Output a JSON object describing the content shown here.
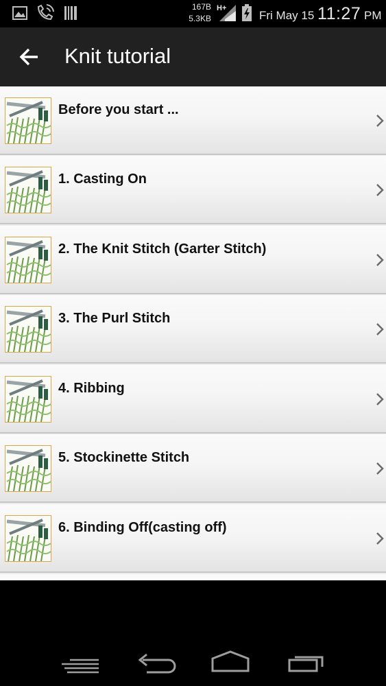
{
  "status_bar": {
    "net_up": "167B",
    "net_down": "5.3KB",
    "date": "Fri May 15",
    "time": "11:27",
    "ampm": "PM",
    "icons": [
      "gallery-icon",
      "wifi-call-icon",
      "barcode-icon",
      "data-hplus-signal-icon",
      "battery-charging-icon"
    ]
  },
  "app_bar": {
    "title": "Knit tutorial",
    "back_icon": "arrow-left-icon"
  },
  "list": {
    "items": [
      {
        "title": "Before you start ..."
      },
      {
        "title": "1. Casting On"
      },
      {
        "title": "2. The Knit Stitch (Garter Stitch)"
      },
      {
        "title": "3. The Purl Stitch"
      },
      {
        "title": "4. Ribbing"
      },
      {
        "title": "5. Stockinette Stitch"
      },
      {
        "title": "6. Binding Off(casting off)"
      }
    ]
  },
  "nav_bar": {
    "buttons": [
      "menu-icon",
      "back-icon",
      "home-icon",
      "recents-icon"
    ]
  }
}
